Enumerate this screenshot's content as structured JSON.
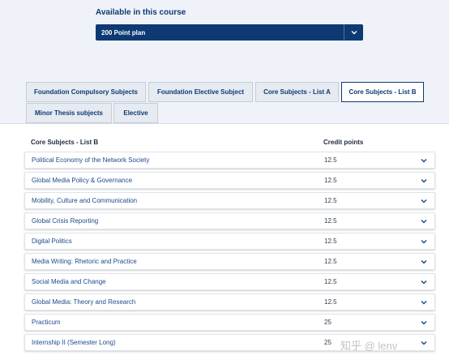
{
  "course": {
    "available_label": "Available in this course",
    "plan_selected": "200 Point plan"
  },
  "tabs": [
    {
      "label": "Foundation Compulsory Subjects",
      "active": false
    },
    {
      "label": "Foundation Elective Subject",
      "active": false
    },
    {
      "label": "Core Subjects - List A",
      "active": false
    },
    {
      "label": "Core Subjects - List B",
      "active": true
    },
    {
      "label": "Minor Thesis subjects",
      "active": false
    },
    {
      "label": "Elective",
      "active": false
    }
  ],
  "table": {
    "header_subject": "Core Subjects - List B",
    "header_credit": "Credit points",
    "rows": [
      {
        "subject": "Political Economy of the Network Society",
        "credit": "12.5",
        "icon": "chevron-down-icon"
      },
      {
        "subject": "Global Media Policy & Governance",
        "credit": "12.5",
        "icon": "chevron-down-icon"
      },
      {
        "subject": "Mobility, Culture and Communication",
        "credit": "12.5",
        "icon": "chevron-down-icon"
      },
      {
        "subject": "Global Crisis Reporting",
        "credit": "12.5",
        "icon": "chevron-down-icon"
      },
      {
        "subject": "Digital Politics",
        "credit": "12.5",
        "icon": "chevron-down-icon"
      },
      {
        "subject": "Media Writing: Rhetoric and Practice",
        "credit": "12.5",
        "icon": "chevron-down-icon"
      },
      {
        "subject": "Social Media and Change",
        "credit": "12.5",
        "icon": "chevron-down-icon"
      },
      {
        "subject": "Global Media: Theory and Research",
        "credit": "12.5",
        "icon": "chevron-down-icon"
      },
      {
        "subject": "Practicum",
        "credit": "25",
        "icon": "chevron-down-icon"
      },
      {
        "subject": "Internship II (Semester Long)",
        "credit": "25",
        "icon": "chevron-down-icon"
      }
    ]
  },
  "watermark": {
    "text": "知乎 @ lenv"
  },
  "colors": {
    "brand_navy": "#0e3a74",
    "band_bg": "#eff2f8",
    "link_blue": "#1e4b8a"
  }
}
